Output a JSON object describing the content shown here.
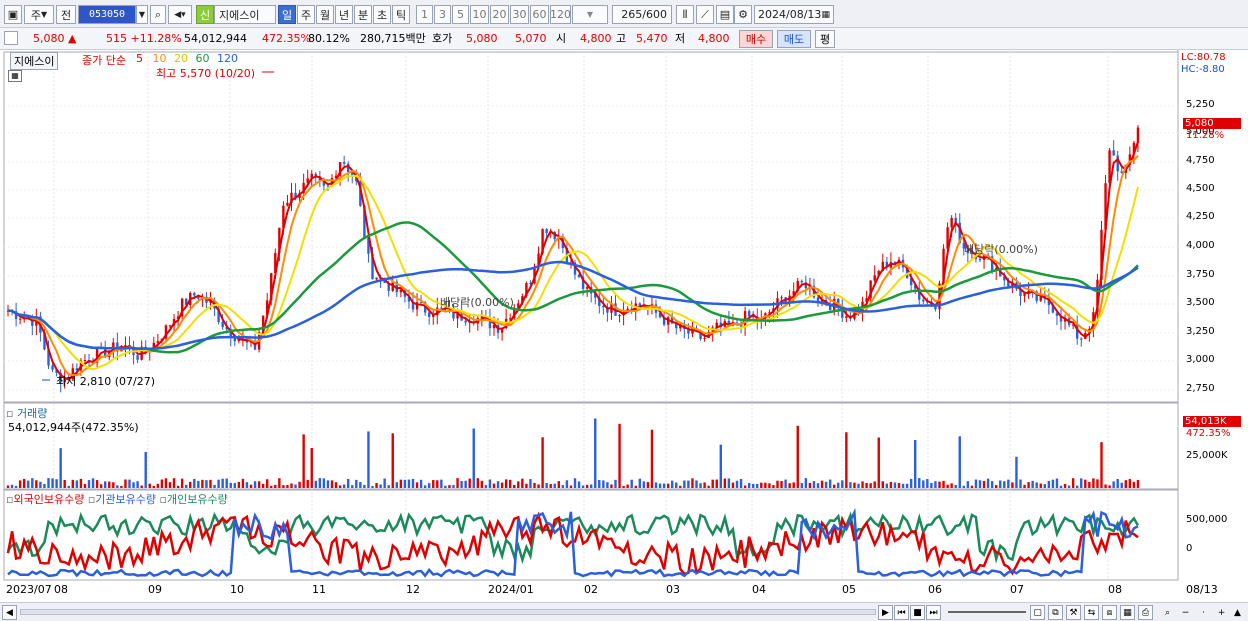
{
  "toolbar": {
    "market": "주",
    "prev_label": "전",
    "code": "053050",
    "badge": "신",
    "name": "지에스이",
    "periods": [
      "일",
      "주",
      "월",
      "년",
      "분",
      "초",
      "틱"
    ],
    "counts": [
      "1",
      "3",
      "5",
      "10",
      "20",
      "30",
      "60",
      "120"
    ],
    "count_value": "265",
    "count_max": "/600",
    "date": "2024/08/13"
  },
  "quote": {
    "price": "5,080",
    "arrow": "▲",
    "change": "515",
    "change_pct": "+11.28%",
    "volume": "54,012,944",
    "vol_pct": "472.35%",
    "rotation": "80.12%",
    "amount": "280,715백만",
    "hoga_label": "호가",
    "hoga1": "5,080",
    "hoga2": "5,070",
    "open_label": "시",
    "open": "4,800",
    "high_label": "고",
    "high": "5,470",
    "low_label": "저",
    "low": "4,800",
    "buy": "매수",
    "sell": "매도",
    "avg": "평"
  },
  "price_panel": {
    "name": "지에스이",
    "legend_title": "종가 단순",
    "ma": [
      "5",
      "10",
      "20",
      "60",
      "120"
    ],
    "ma_colors": [
      "#e00000",
      "#ff8c00",
      "#f0e000",
      "#1a9a3a",
      "#2a5fe0"
    ],
    "high_note": "최고 5,570 (10/20)",
    "low_note": "최저 2,810 (07/27)",
    "div1": "배당락(0.00%)",
    "div2": "배당락(0.00%)",
    "lc": "LC:80.78",
    "hc": "HC:-8.80",
    "y_ticks": [
      "5,250",
      "5,000",
      "4,750",
      "4,500",
      "4,250",
      "4,000",
      "3,750",
      "3,500",
      "3,250",
      "3,000",
      "2,750"
    ],
    "last_price": "5,080",
    "last_pct": "11.28%"
  },
  "volume_panel": {
    "title": "거래량",
    "value": "54,012,944주(472.35%)",
    "tick": "25,000K",
    "last": "54,013K",
    "last_pct": "472.35%"
  },
  "holding_panel": {
    "title1": "외국인보유수량",
    "title2": "기관보유수량",
    "title3": "개인보유수량",
    "ticks": [
      "500,000",
      "0"
    ]
  },
  "x_axis": [
    "2023/07",
    "08",
    "09",
    "10",
    "11",
    "12",
    "2024/01",
    "02",
    "03",
    "04",
    "05",
    "06",
    "07",
    "08",
    "08/13"
  ],
  "chart_data": {
    "type": "candlestick",
    "price_y_range": [
      2700,
      5500
    ],
    "price_close_approx": [
      3450,
      3400,
      3350,
      2900,
      2850,
      3000,
      3050,
      3100,
      3150,
      3050,
      3150,
      3300,
      3500,
      3600,
      3500,
      3300,
      3200,
      3100,
      3600,
      4400,
      4500,
      4600,
      4500,
      4800,
      4600,
      3800,
      3700,
      3600,
      3500,
      3450,
      3450,
      3400,
      3400,
      3350,
      3300,
      3500,
      3700,
      4200,
      4100,
      3800,
      3600,
      3500,
      3450,
      3500,
      3500,
      3400,
      3300,
      3250,
      3200,
      3300,
      3300,
      3400,
      3350,
      3500,
      3600,
      3700,
      3550,
      3500,
      3400,
      3500,
      3800,
      3900,
      3800,
      3550,
      3500,
      4300,
      4000,
      3950,
      3850,
      3700,
      3600,
      3550,
      3500,
      3350,
      3200,
      3400,
      4900,
      4600,
      5080
    ]
  }
}
